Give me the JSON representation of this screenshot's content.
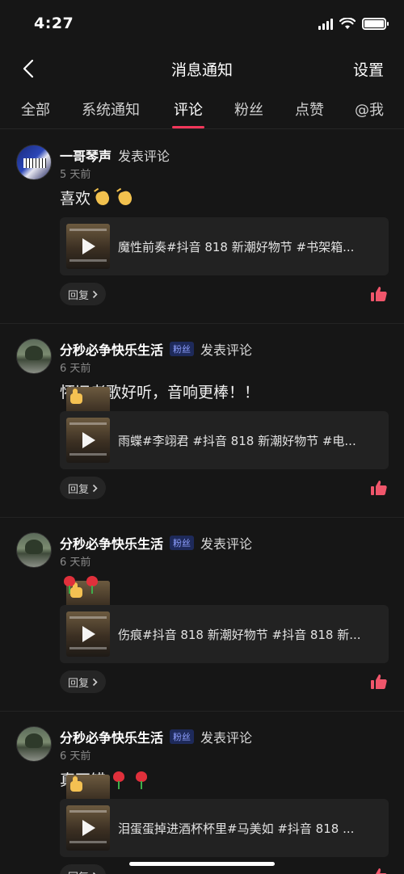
{
  "status": {
    "time": "4:27"
  },
  "nav": {
    "title": "消息通知",
    "settings_label": "设置"
  },
  "tabs": [
    {
      "label": "全部"
    },
    {
      "label": "系统通知"
    },
    {
      "label": "评论",
      "active": true
    },
    {
      "label": "粉丝"
    },
    {
      "label": "点赞"
    },
    {
      "label": "@我"
    }
  ],
  "colors": {
    "accent": "#f2375a",
    "like": "#f0566b",
    "background": "#161616",
    "card": "#222222"
  },
  "items": [
    {
      "username": "一哥琴声",
      "is_fan": false,
      "action": "发表评论",
      "time": "5 天前",
      "comment": "喜欢",
      "emojis": [
        "clap",
        "clap"
      ],
      "video_title": "魔性前奏#抖音 818 新潮好物节 #书架箱...",
      "reply_label": "回复",
      "avatar_icon": "piano-avatar"
    },
    {
      "username": "分秒必争快乐生活",
      "is_fan": true,
      "fan_label": "粉丝",
      "action": "发表评论",
      "time": "6 天前",
      "comment": "怀旧老歌好听，音响更棒！！",
      "emojis": [
        "thumbs-up",
        "thumbs-up"
      ],
      "video_title": "雨蝶#李翊君 #抖音 818 新潮好物节 #电...",
      "reply_label": "回复",
      "avatar_icon": "park-avatar"
    },
    {
      "username": "分秒必争快乐生活",
      "is_fan": true,
      "fan_label": "粉丝",
      "action": "发表评论",
      "time": "6 天前",
      "comment": "",
      "emojis": [
        "thumbs-up",
        "thumbs-up",
        "rose",
        "rose"
      ],
      "video_title": "伤痕#抖音 818 新潮好物节 #抖音 818 新...",
      "reply_label": "回复",
      "avatar_icon": "park-avatar"
    },
    {
      "username": "分秒必争快乐生活",
      "is_fan": true,
      "fan_label": "粉丝",
      "action": "发表评论",
      "time": "6 天前",
      "comment": "真不错",
      "emojis": [
        "thumbs-up",
        "thumbs-up",
        "rose",
        "rose"
      ],
      "video_title": "泪蛋蛋掉进酒杯杯里#马美如 #抖音 818 ...",
      "reply_label": "回复",
      "avatar_icon": "park-avatar"
    }
  ]
}
